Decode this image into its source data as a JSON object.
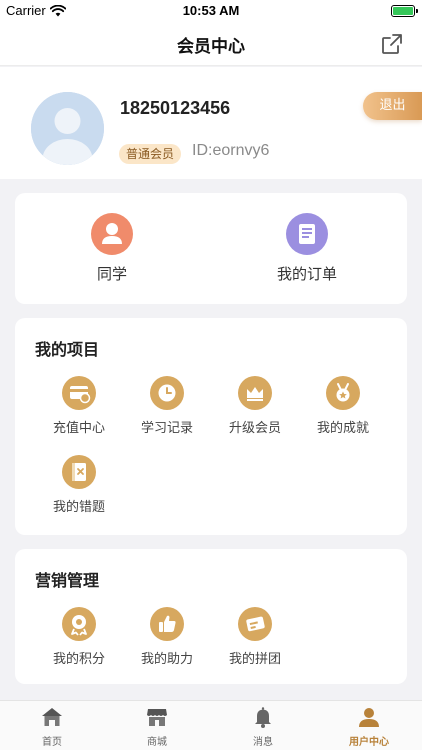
{
  "status_bar": {
    "carrier": "Carrier",
    "time": "10:53 AM"
  },
  "nav": {
    "title": "会员中心"
  },
  "profile": {
    "phone": "18250123456",
    "level": "普通会员",
    "id": "ID:eornvy6",
    "logout_label": "退出"
  },
  "quick": [
    {
      "label": "同学",
      "color": "#f08b6b"
    },
    {
      "label": "我的订单",
      "color": "#9b8fe0"
    }
  ],
  "projects": {
    "title": "我的项目",
    "items": [
      {
        "label": "充值中心",
        "icon": "recharge-card-icon"
      },
      {
        "label": "学习记录",
        "icon": "clock-icon"
      },
      {
        "label": "升级会员",
        "icon": "crown-icon"
      },
      {
        "label": "我的成就",
        "icon": "medal-icon"
      },
      {
        "label": "我的错题",
        "icon": "error-book-icon"
      }
    ]
  },
  "marketing": {
    "title": "营销管理",
    "items": [
      {
        "label": "我的积分",
        "icon": "points-icon"
      },
      {
        "label": "我的助力",
        "icon": "thumbs-up-icon"
      },
      {
        "label": "我的拼团",
        "icon": "group-ticket-icon"
      }
    ]
  },
  "tabbar": [
    {
      "label": "首页",
      "icon": "home-icon",
      "active": false
    },
    {
      "label": "商城",
      "icon": "shop-icon",
      "active": false
    },
    {
      "label": "消息",
      "icon": "bell-icon",
      "active": false
    },
    {
      "label": "用户中心",
      "icon": "user-icon",
      "active": true
    }
  ],
  "colors": {
    "accent": "#d7a85f",
    "active_tab": "#b8823a",
    "battery": "#35c759"
  }
}
